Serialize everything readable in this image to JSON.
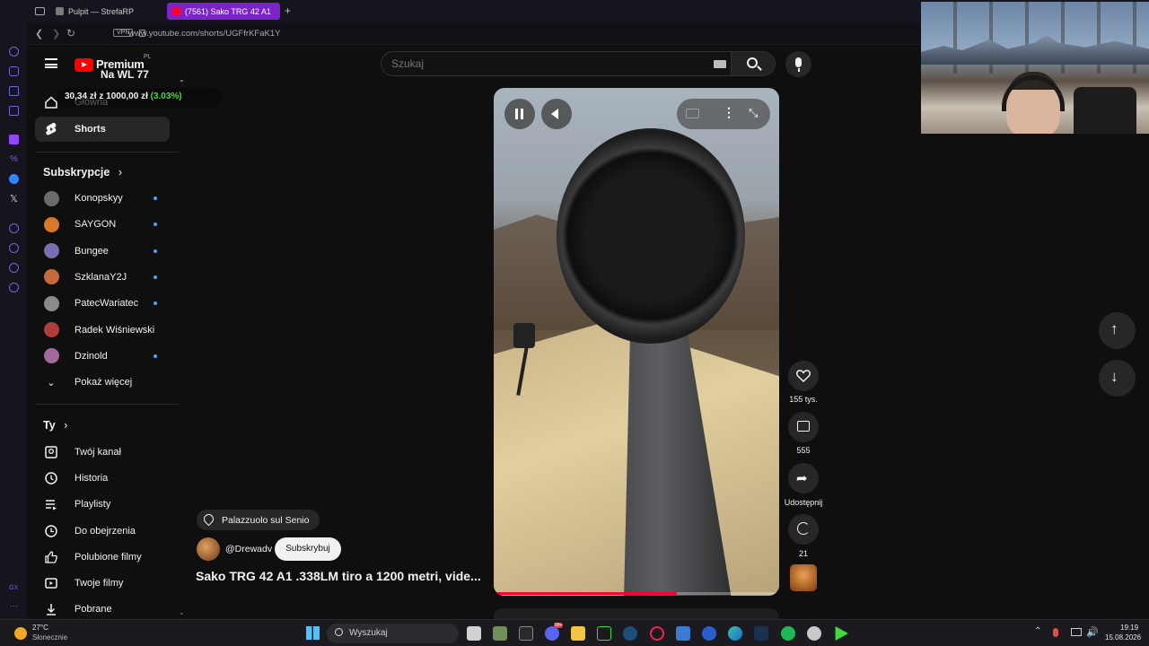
{
  "browser": {
    "tabs": [
      {
        "label": "Pulpit — StrefaRP"
      },
      {
        "label": "(7561) Sako TRG 42 A1"
      }
    ],
    "new_tab": "+",
    "vpn_badge": "VPN",
    "url": "www.youtube.com/shorts/UGFfrKFaK1Y"
  },
  "header": {
    "logo_line1": "Premium",
    "logo_line2": "Na WL 77",
    "logo_region": "PL",
    "search_placeholder": "Szukaj",
    "overlay_stat": "30,34 zł z 1000,00 zł",
    "overlay_percent": "(3.03%)"
  },
  "guide": {
    "home_label": "Główna",
    "shorts_label": "Shorts",
    "subscriptions_title": "Subskrypcje",
    "channels": [
      {
        "name": "Konopskyy",
        "color": "#6b6b6b",
        "new": true
      },
      {
        "name": "SAYGON",
        "color": "#d9772b",
        "new": true
      },
      {
        "name": "Bungee",
        "color": "#7a6fb0",
        "new": true
      },
      {
        "name": "SzklanaY2J",
        "color": "#c76a3e",
        "new": true
      },
      {
        "name": "PatecWariatec",
        "color": "#8a8a8a",
        "new": true
      },
      {
        "name": "Radek Wiśniewski",
        "color": "#b23b3b",
        "new": false
      },
      {
        "name": "Dzinold",
        "color": "#a06a9a",
        "new": true
      }
    ],
    "show_more": "Pokaż więcej",
    "you_title": "Ty",
    "you_items": [
      {
        "label": "Twój kanał",
        "icon": "account-box-icon"
      },
      {
        "label": "Historia",
        "icon": "history-icon"
      },
      {
        "label": "Playlisty",
        "icon": "playlist-icon"
      },
      {
        "label": "Do obejrzenia",
        "icon": "clock-icon"
      },
      {
        "label": "Polubione filmy",
        "icon": "thumb-up-icon"
      },
      {
        "label": "Twoje filmy",
        "icon": "play-square-icon"
      },
      {
        "label": "Pobrane",
        "icon": "download-icon"
      }
    ]
  },
  "short": {
    "location": "Palazzuolo sul Senio",
    "channel": "@Drewadv",
    "subscribe": "Subskrybuj",
    "title": "Sako TRG 42 A1 .338LM tiro a 1200 metri, vide...",
    "progress": 0.64
  },
  "actions": {
    "likes": "155 tys.",
    "comments": "555",
    "share": "Udostępnij",
    "remix": "21"
  },
  "taskbar": {
    "weather_temp": "27°C",
    "weather_desc": "Słonecznie",
    "search": "Wyszukaj",
    "time": "19:19",
    "date": "15.08.2026",
    "badge": "99+"
  },
  "colors": {
    "accent_red": "#ff0000",
    "overlay_green": "#3ddc3d",
    "subscribe_bg": "#f1f1f1",
    "opera_tab": "#8b1cf0"
  }
}
